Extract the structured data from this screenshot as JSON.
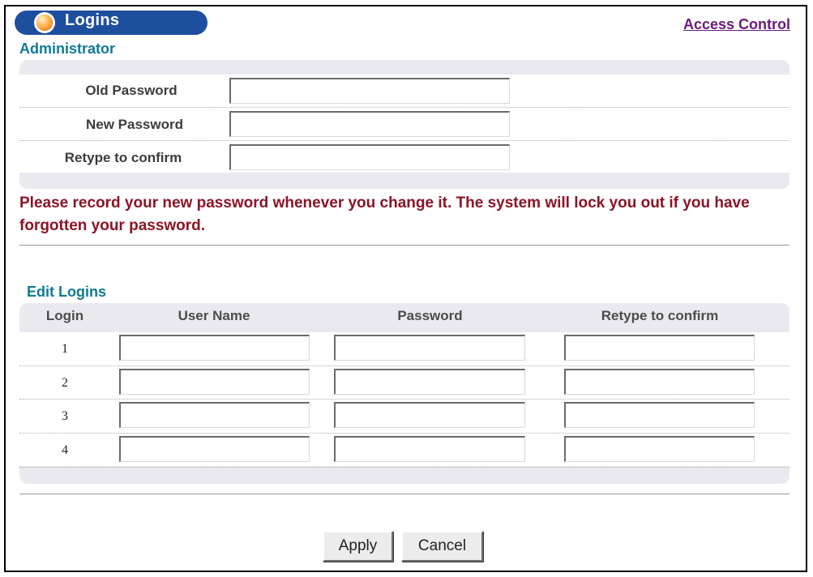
{
  "header": {
    "tab_label": "Logins",
    "access_link": "Access Control"
  },
  "administrator": {
    "title": "Administrator",
    "fields": [
      {
        "label": "Old Password",
        "value": ""
      },
      {
        "label": "New Password",
        "value": ""
      },
      {
        "label": "Retype to confirm",
        "value": ""
      }
    ]
  },
  "warning_text": "Please record your new password whenever you change it. The system will lock you out if you have forgotten your password.",
  "edit_logins": {
    "title": "Edit Logins",
    "columns": [
      "Login",
      "User Name",
      "Password",
      "Retype to confirm"
    ],
    "rows": [
      {
        "login": "1",
        "user_name": "",
        "password": "",
        "retype": ""
      },
      {
        "login": "2",
        "user_name": "",
        "password": "",
        "retype": ""
      },
      {
        "login": "3",
        "user_name": "",
        "password": "",
        "retype": ""
      },
      {
        "login": "4",
        "user_name": "",
        "password": "",
        "retype": ""
      }
    ]
  },
  "buttons": {
    "apply": "Apply",
    "cancel": "Cancel"
  },
  "colors": {
    "tab_blue": "#1e4e9e",
    "section_title": "#0f7a93",
    "warning_red": "#8b1426",
    "link_purple": "#6b1a7f",
    "panel_gray": "#e9e9ef"
  },
  "icons": {
    "tab_icon": "orange-bulb-icon"
  }
}
